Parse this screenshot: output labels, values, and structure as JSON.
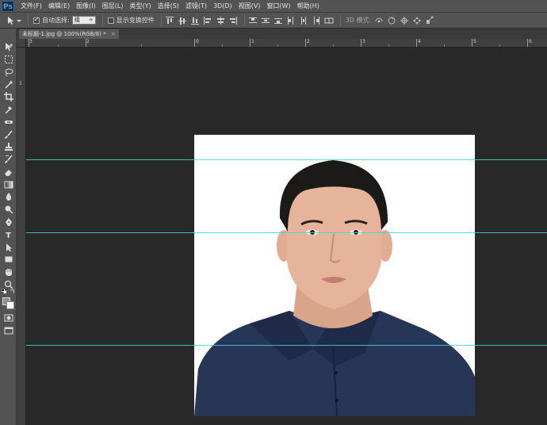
{
  "app": {
    "logo": "Ps"
  },
  "menu": [
    "文件(F)",
    "编辑(E)",
    "图像(I)",
    "图层(L)",
    "类型(Y)",
    "选择(S)",
    "滤镜(T)",
    "3D(D)",
    "视图(V)",
    "窗口(W)",
    "帮助(H)"
  ],
  "options": {
    "auto_select_label": "自动选择:",
    "auto_select_value": "组",
    "show_transform_label": "显示变换控件",
    "mode_3d_label": "3D 模式:"
  },
  "document": {
    "tab_title": "未标题-1.jpg @ 100%(RGB/8) *",
    "close": "×"
  },
  "ruler": {
    "top_labels": [
      "3",
      "2",
      "0",
      "1",
      "2",
      "3",
      "4",
      "5",
      "6"
    ],
    "left_labels": [
      "1"
    ]
  },
  "colors": {
    "guide": "#3fd6d8",
    "canvas_bg": "#282828",
    "ui_panel": "#535353"
  },
  "icons": {
    "tools": [
      "move-tool-icon",
      "marquee-tool-icon",
      "lasso-tool-icon",
      "magic-wand-icon",
      "crop-tool-icon",
      "eyedropper-icon",
      "healing-brush-icon",
      "brush-tool-icon",
      "clone-stamp-icon",
      "history-brush-icon",
      "eraser-icon",
      "gradient-icon",
      "blur-icon",
      "dodge-icon",
      "pen-tool-icon",
      "type-tool-icon",
      "path-selection-icon",
      "rectangle-shape-icon",
      "hand-tool-icon",
      "zoom-tool-icon"
    ]
  }
}
